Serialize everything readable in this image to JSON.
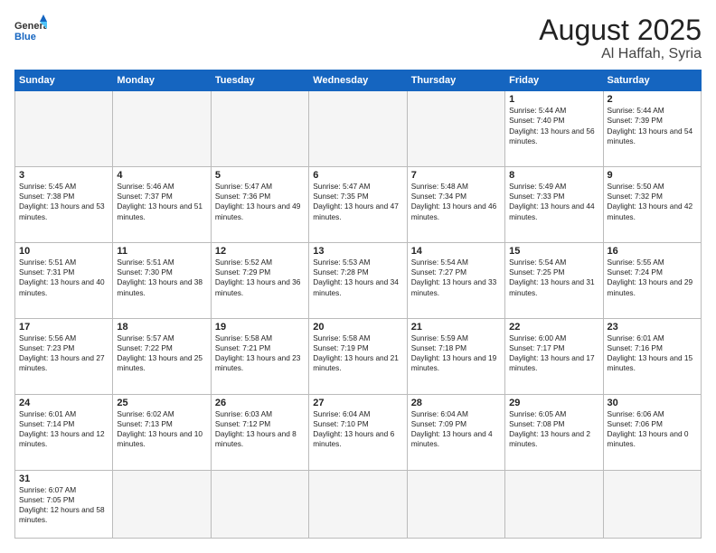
{
  "header": {
    "logo_general": "General",
    "logo_blue": "Blue",
    "month": "August 2025",
    "location": "Al Haffah, Syria"
  },
  "weekdays": [
    "Sunday",
    "Monday",
    "Tuesday",
    "Wednesday",
    "Thursday",
    "Friday",
    "Saturday"
  ],
  "weeks": [
    [
      {
        "day": "",
        "info": ""
      },
      {
        "day": "",
        "info": ""
      },
      {
        "day": "",
        "info": ""
      },
      {
        "day": "",
        "info": ""
      },
      {
        "day": "",
        "info": ""
      },
      {
        "day": "1",
        "info": "Sunrise: 5:44 AM\nSunset: 7:40 PM\nDaylight: 13 hours and 56 minutes."
      },
      {
        "day": "2",
        "info": "Sunrise: 5:44 AM\nSunset: 7:39 PM\nDaylight: 13 hours and 54 minutes."
      }
    ],
    [
      {
        "day": "3",
        "info": "Sunrise: 5:45 AM\nSunset: 7:38 PM\nDaylight: 13 hours and 53 minutes."
      },
      {
        "day": "4",
        "info": "Sunrise: 5:46 AM\nSunset: 7:37 PM\nDaylight: 13 hours and 51 minutes."
      },
      {
        "day": "5",
        "info": "Sunrise: 5:47 AM\nSunset: 7:36 PM\nDaylight: 13 hours and 49 minutes."
      },
      {
        "day": "6",
        "info": "Sunrise: 5:47 AM\nSunset: 7:35 PM\nDaylight: 13 hours and 47 minutes."
      },
      {
        "day": "7",
        "info": "Sunrise: 5:48 AM\nSunset: 7:34 PM\nDaylight: 13 hours and 46 minutes."
      },
      {
        "day": "8",
        "info": "Sunrise: 5:49 AM\nSunset: 7:33 PM\nDaylight: 13 hours and 44 minutes."
      },
      {
        "day": "9",
        "info": "Sunrise: 5:50 AM\nSunset: 7:32 PM\nDaylight: 13 hours and 42 minutes."
      }
    ],
    [
      {
        "day": "10",
        "info": "Sunrise: 5:51 AM\nSunset: 7:31 PM\nDaylight: 13 hours and 40 minutes."
      },
      {
        "day": "11",
        "info": "Sunrise: 5:51 AM\nSunset: 7:30 PM\nDaylight: 13 hours and 38 minutes."
      },
      {
        "day": "12",
        "info": "Sunrise: 5:52 AM\nSunset: 7:29 PM\nDaylight: 13 hours and 36 minutes."
      },
      {
        "day": "13",
        "info": "Sunrise: 5:53 AM\nSunset: 7:28 PM\nDaylight: 13 hours and 34 minutes."
      },
      {
        "day": "14",
        "info": "Sunrise: 5:54 AM\nSunset: 7:27 PM\nDaylight: 13 hours and 33 minutes."
      },
      {
        "day": "15",
        "info": "Sunrise: 5:54 AM\nSunset: 7:25 PM\nDaylight: 13 hours and 31 minutes."
      },
      {
        "day": "16",
        "info": "Sunrise: 5:55 AM\nSunset: 7:24 PM\nDaylight: 13 hours and 29 minutes."
      }
    ],
    [
      {
        "day": "17",
        "info": "Sunrise: 5:56 AM\nSunset: 7:23 PM\nDaylight: 13 hours and 27 minutes."
      },
      {
        "day": "18",
        "info": "Sunrise: 5:57 AM\nSunset: 7:22 PM\nDaylight: 13 hours and 25 minutes."
      },
      {
        "day": "19",
        "info": "Sunrise: 5:58 AM\nSunset: 7:21 PM\nDaylight: 13 hours and 23 minutes."
      },
      {
        "day": "20",
        "info": "Sunrise: 5:58 AM\nSunset: 7:19 PM\nDaylight: 13 hours and 21 minutes."
      },
      {
        "day": "21",
        "info": "Sunrise: 5:59 AM\nSunset: 7:18 PM\nDaylight: 13 hours and 19 minutes."
      },
      {
        "day": "22",
        "info": "Sunrise: 6:00 AM\nSunset: 7:17 PM\nDaylight: 13 hours and 17 minutes."
      },
      {
        "day": "23",
        "info": "Sunrise: 6:01 AM\nSunset: 7:16 PM\nDaylight: 13 hours and 15 minutes."
      }
    ],
    [
      {
        "day": "24",
        "info": "Sunrise: 6:01 AM\nSunset: 7:14 PM\nDaylight: 13 hours and 12 minutes."
      },
      {
        "day": "25",
        "info": "Sunrise: 6:02 AM\nSunset: 7:13 PM\nDaylight: 13 hours and 10 minutes."
      },
      {
        "day": "26",
        "info": "Sunrise: 6:03 AM\nSunset: 7:12 PM\nDaylight: 13 hours and 8 minutes."
      },
      {
        "day": "27",
        "info": "Sunrise: 6:04 AM\nSunset: 7:10 PM\nDaylight: 13 hours and 6 minutes."
      },
      {
        "day": "28",
        "info": "Sunrise: 6:04 AM\nSunset: 7:09 PM\nDaylight: 13 hours and 4 minutes."
      },
      {
        "day": "29",
        "info": "Sunrise: 6:05 AM\nSunset: 7:08 PM\nDaylight: 13 hours and 2 minutes."
      },
      {
        "day": "30",
        "info": "Sunrise: 6:06 AM\nSunset: 7:06 PM\nDaylight: 13 hours and 0 minutes."
      }
    ],
    [
      {
        "day": "31",
        "info": "Sunrise: 6:07 AM\nSunset: 7:05 PM\nDaylight: 12 hours and 58 minutes."
      },
      {
        "day": "",
        "info": ""
      },
      {
        "day": "",
        "info": ""
      },
      {
        "day": "",
        "info": ""
      },
      {
        "day": "",
        "info": ""
      },
      {
        "day": "",
        "info": ""
      },
      {
        "day": "",
        "info": ""
      }
    ]
  ]
}
